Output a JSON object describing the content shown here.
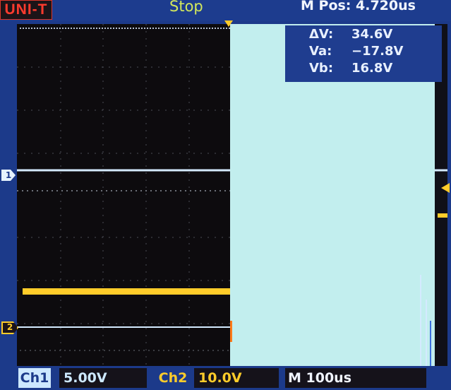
{
  "header": {
    "brand": "UNI-T",
    "run_status": "Stop",
    "memory_position": "M Pos: 4.720us"
  },
  "cursor_readout": {
    "delta_v_label": "ΔV:",
    "delta_v_value": "34.6V",
    "va_label": "Va:",
    "va_value": "−17.8V",
    "vb_label": "Vb:",
    "vb_value": "16.8V"
  },
  "markers": {
    "ch1": "1",
    "ch2": "2"
  },
  "footer": {
    "ch1_label": "Ch1",
    "ch1_scale": "5.00V",
    "ch2_label": "Ch2",
    "ch2_scale": "10.0V",
    "timebase_label": "M 100us"
  },
  "colors": {
    "frame": "#1c3a8a",
    "ch1": "#cde8ff",
    "ch2": "#ffcc2a",
    "brand": "#ff3b2e"
  }
}
